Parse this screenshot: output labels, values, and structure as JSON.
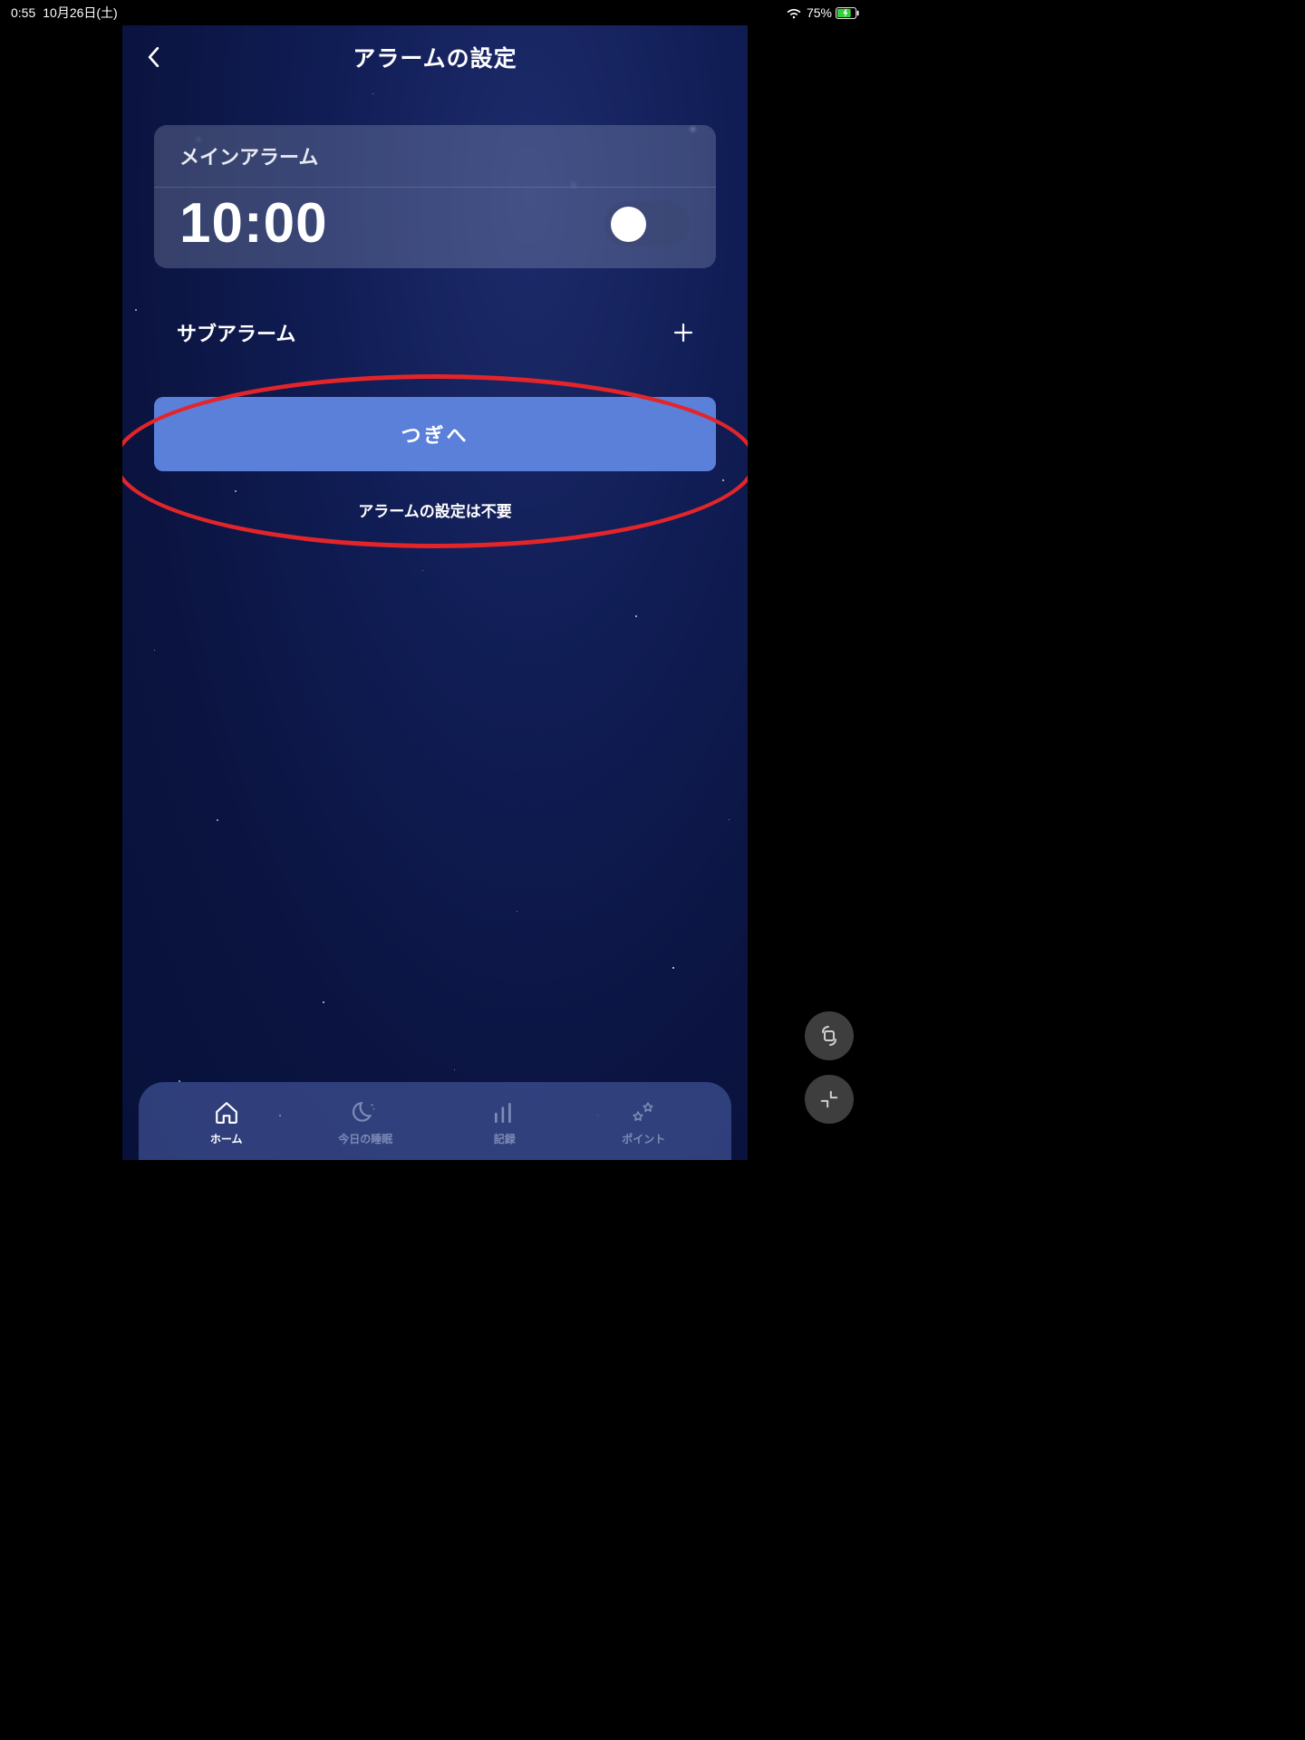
{
  "status": {
    "time": "0:55",
    "date": "10月26日(土)",
    "battery_pct": "75%"
  },
  "header": {
    "title": "アラームの設定"
  },
  "main_alarm": {
    "label": "メインアラーム",
    "time": "10:00"
  },
  "sub_alarm": {
    "label": "サブアラーム"
  },
  "actions": {
    "next": "つぎへ",
    "skip": "アラームの設定は不要"
  },
  "tabs": {
    "home": "ホーム",
    "today": "今日の睡眠",
    "records": "記録",
    "points": "ポイント"
  }
}
